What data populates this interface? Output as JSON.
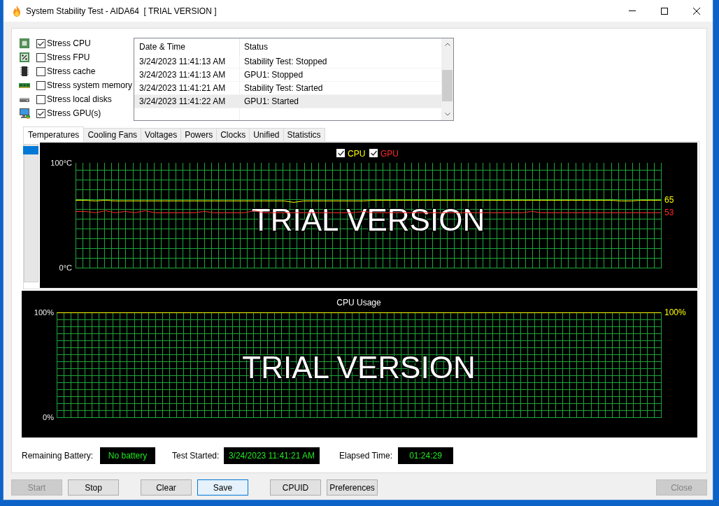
{
  "window": {
    "title": "System Stability Test - AIDA64  [ TRIAL VERSION ]"
  },
  "stress_options": [
    {
      "kind": "cpu",
      "label": "Stress CPU",
      "checked": true
    },
    {
      "kind": "fpu",
      "label": "Stress FPU",
      "checked": false
    },
    {
      "kind": "cache",
      "label": "Stress cache",
      "checked": false
    },
    {
      "kind": "memory",
      "label": "Stress system memory",
      "checked": false
    },
    {
      "kind": "disk",
      "label": "Stress local disks",
      "checked": false
    },
    {
      "kind": "gpu",
      "label": "Stress GPU(s)",
      "checked": true
    }
  ],
  "log": {
    "columns": [
      "Date & Time",
      "Status"
    ],
    "rows": [
      {
        "cells": [
          "3/24/2023 11:41:13 AM",
          "Stability Test: Stopped"
        ],
        "selected": false
      },
      {
        "cells": [
          "3/24/2023 11:41:13 AM",
          "GPU1: Stopped"
        ],
        "selected": false
      },
      {
        "cells": [
          "3/24/2023 11:41:21 AM",
          "Stability Test: Started"
        ],
        "selected": false
      },
      {
        "cells": [
          "3/24/2023 11:41:22 AM",
          "GPU1: Started"
        ],
        "selected": true
      }
    ]
  },
  "tabs": [
    {
      "label": "Temperatures",
      "selected": true
    },
    {
      "label": "Cooling Fans",
      "selected": false
    },
    {
      "label": "Voltages",
      "selected": false
    },
    {
      "label": "Powers",
      "selected": false
    },
    {
      "label": "Clocks",
      "selected": false
    },
    {
      "label": "Unified",
      "selected": false
    },
    {
      "label": "Statistics",
      "selected": false
    }
  ],
  "temperature_graph": {
    "legend_checkboxes": [
      {
        "checked": true
      },
      {
        "checked": true
      }
    ],
    "current_values": [
      "65",
      "53"
    ],
    "chart_data": [
      {
        "type": "line",
        "legend": "top",
        "grid": true,
        "tick_labels": "y",
        "ylim": [
          0,
          100
        ],
        "yticks": [
          {
            "value": 0,
            "label": "0°C"
          },
          {
            "value": 100,
            "label": "100°C"
          }
        ],
        "series": [
          {
            "name": "CPU",
            "color": "#ffff00",
            "values": [
              65,
              65,
              64,
              65,
              64,
              64,
              64,
              64,
              64,
              64,
              64,
              64,
              64,
              64,
              64,
              64,
              64,
              64,
              64,
              64,
              64,
              64,
              63,
              64,
              64,
              64,
              64,
              64,
              64,
              64,
              65,
              65,
              65,
              65,
              65,
              65,
              65,
              65,
              65,
              65,
              65,
              65,
              65,
              65,
              65,
              65,
              65,
              65,
              65,
              65,
              65,
              65,
              65,
              65,
              65,
              64,
              64,
              65,
              65,
              65
            ]
          },
          {
            "name": "GPU",
            "color": "#ff2a2a",
            "values": [
              54,
              54,
              53,
              55,
              53,
              54,
              53,
              55,
              53,
              53,
              53,
              53,
              53,
              54,
              53,
              53,
              53,
              53,
              55,
              53,
              53,
              53,
              53,
              53,
              53,
              53,
              53,
              53,
              53,
              54,
              53,
              53,
              53,
              53,
              53,
              53,
              53,
              53,
              53,
              53,
              53,
              53,
              53,
              53,
              53,
              53,
              54,
              53,
              53,
              53,
              53,
              53,
              53,
              53,
              53,
              53,
              53,
              53,
              53,
              53
            ]
          }
        ],
        "annotations": [
          "TRIAL VERSION"
        ]
      }
    ]
  },
  "usage_graph": {
    "current_values": [
      "100%"
    ],
    "chart_data": [
      {
        "type": "line",
        "title": "CPU Usage",
        "grid": true,
        "tick_labels": "y",
        "ylim": [
          0,
          100
        ],
        "yticks": [
          {
            "value": 0,
            "label": "0%"
          },
          {
            "value": 100,
            "label": "100%"
          }
        ],
        "series": [
          {
            "color": "#ffff00",
            "values": [
              100,
              100,
              100,
              100,
              100,
              100,
              100,
              100,
              100,
              100,
              100,
              100,
              100,
              100,
              100,
              100,
              100,
              100,
              100,
              100,
              100,
              100,
              100,
              100,
              100,
              100,
              100,
              100,
              100,
              100
            ]
          }
        ],
        "annotations": [
          "TRIAL VERSION"
        ]
      }
    ]
  },
  "readouts": [
    {
      "label": "Remaining Battery:",
      "value": "No battery"
    },
    {
      "label": "Test Started:",
      "value": "3/24/2023 11:41:21 AM"
    },
    {
      "label": "Elapsed Time:",
      "value": "01:24:29"
    }
  ],
  "button_groups": [
    [
      {
        "label": "Start",
        "disabled": true,
        "focused": false
      },
      {
        "label": "Stop",
        "disabled": false,
        "focused": false
      }
    ],
    [
      {
        "label": "Clear",
        "disabled": false,
        "focused": false
      },
      {
        "label": "Save",
        "disabled": false,
        "focused": true
      }
    ],
    [
      {
        "label": "CPUID",
        "disabled": false,
        "focused": false
      },
      {
        "label": "Preferences",
        "disabled": false,
        "focused": false
      }
    ],
    [
      {
        "label": "Close",
        "disabled": true,
        "focused": false
      }
    ]
  ]
}
